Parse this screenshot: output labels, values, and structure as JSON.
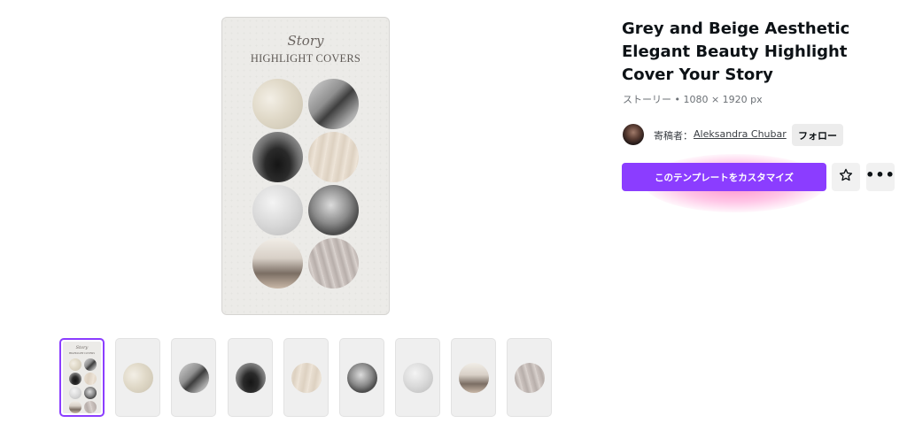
{
  "preview": {
    "script_text": "Story",
    "caps_text": "HIGHLIGHT COVERS"
  },
  "template": {
    "title": "Grey and Beige Aesthetic Elegant Beauty Highlight Cover Your Story",
    "meta": "ストーリー • 1080 × 1920 px"
  },
  "creator": {
    "by_label": "寄稿者：",
    "name": "Aleksandra Chubar",
    "follow_label": "フォロー"
  },
  "actions": {
    "customize_label": "このテンプレートをカスタマイズ",
    "favorite_icon": "star-icon",
    "more_icon": "more-dots-icon"
  },
  "thumbnails": {
    "count": 9,
    "selected_index": 0,
    "items": [
      "page-1",
      "cream-fabric",
      "grey-figure",
      "dark-silhouette",
      "beige-drape",
      "monochrome-portrait",
      "white-texture",
      "beige-legs",
      "pleated-fabric"
    ]
  },
  "colors": {
    "accent": "#8b3dff",
    "highlight": "#ff8cc8"
  }
}
